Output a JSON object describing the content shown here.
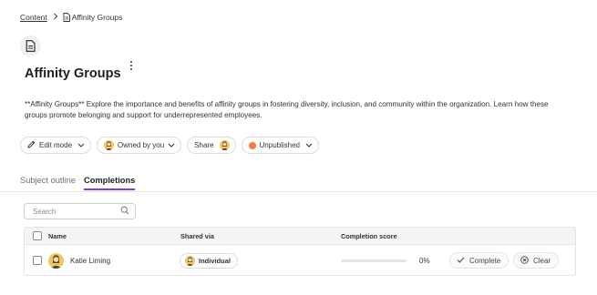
{
  "breadcrumb": {
    "parent": "Content",
    "current": "Affinity Groups"
  },
  "page": {
    "title": "Affinity Groups",
    "description": "**Affinity Groups** Explore the importance and benefits of affinity groups in fostering diversity, inclusion, and community within the organization. Learn how these groups promote belonging and support for underrepresented employees."
  },
  "actions": {
    "edit_mode": "Edit mode",
    "owned_by": "Owned by you",
    "share": "Share",
    "status": "Unpublished",
    "status_color": "#f27d3e"
  },
  "tabs": [
    {
      "label": "Subject outline",
      "active": false
    },
    {
      "label": "Completions",
      "active": true
    }
  ],
  "accent_color": "#7c3aed",
  "search": {
    "placeholder": "Search"
  },
  "table": {
    "columns": {
      "name": "Name",
      "shared_via": "Shared via",
      "completion_score": "Completion score"
    },
    "rows": [
      {
        "name": "Katie Liming",
        "shared_via": "Individual",
        "score_label": "0%",
        "score_fraction": 0,
        "complete_label": "Complete",
        "clear_label": "Clear"
      }
    ]
  },
  "icons": {
    "breadcrumb_separator": "chevron-right-icon",
    "document": "document-icon",
    "more": "kebab-menu-icon",
    "edit": "pencil-icon",
    "dropdown": "chevron-down-icon",
    "search": "search-icon",
    "complete": "check-icon",
    "clear": "close-circle-icon"
  }
}
